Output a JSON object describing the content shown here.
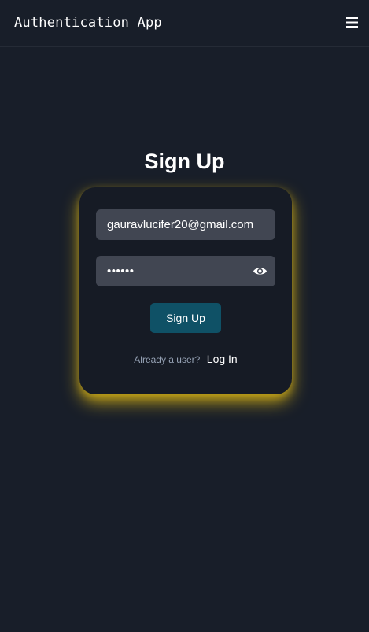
{
  "navbar": {
    "title": "Authentication App",
    "menu_icon": "hamburger-menu-icon"
  },
  "form": {
    "heading": "Sign Up",
    "email_value": "gauravlucifer20@gmail.com",
    "password_masked": "••••••",
    "password_toggle_icon": "eye-icon",
    "submit_label": "Sign Up",
    "login_prompt": "Already a user?",
    "login_link": "Log In"
  },
  "colors": {
    "background": "#181e29",
    "card": "#161b25",
    "card_glow": "#e6be14",
    "input": "#414652",
    "button": "#0f5166"
  }
}
